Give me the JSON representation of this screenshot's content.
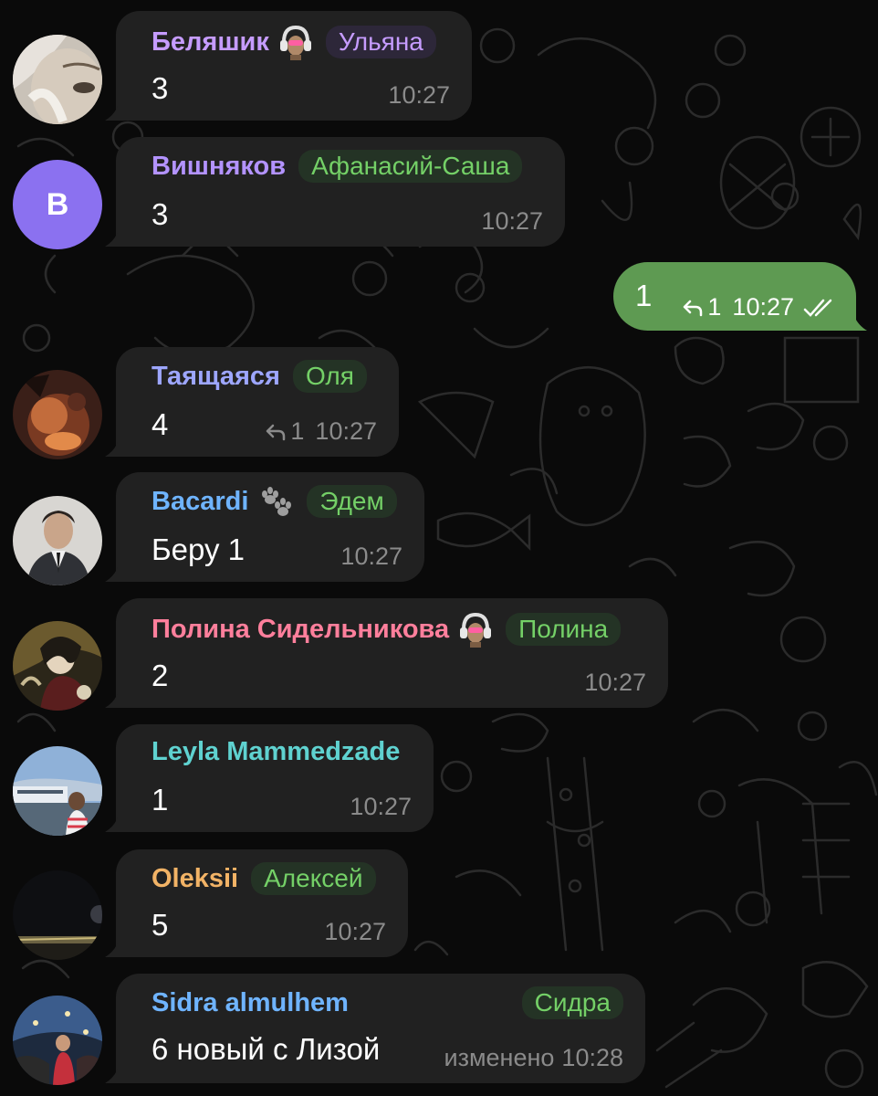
{
  "colors": {
    "background": "#0a0a0a",
    "bubble": "#212121",
    "outgoing_bubble": "#5e9a52",
    "meta": "#8b8b8b"
  },
  "outgoing": {
    "text": "1",
    "reply_count": "1",
    "time": "10:27",
    "status": "double-check-read"
  },
  "messages": [
    {
      "sender": "Беляшик",
      "sender_color": "#c69cff",
      "tag": "Ульяна",
      "tag_color": "#c69cff",
      "tag_bg": "#2d2739",
      "badge": "headphones-emoji",
      "text": "3",
      "time": "10:27",
      "avatar": "photo"
    },
    {
      "sender": "Вишняков",
      "sender_color": "#b393ff",
      "tag": "Афанасий-Саша",
      "tag_color": "#74d067",
      "tag_bg": "#243325",
      "text": "3",
      "time": "10:27",
      "avatar": "initial",
      "initial": "В",
      "avatar_color": "#8b71f0"
    },
    {
      "sender": "Таящаяся",
      "sender_color": "#9da6ff",
      "tag": "Оля",
      "tag_color": "#74d067",
      "tag_bg": "#243325",
      "text": "4",
      "reply_count": "1",
      "time": "10:27",
      "avatar": "photo"
    },
    {
      "sender": "Bacardi",
      "sender_color": "#6fb4ff",
      "badge": "paws-emoji",
      "tag": "Эдем",
      "tag_color": "#74d067",
      "tag_bg": "#243325",
      "text": "Беру 1",
      "time": "10:27",
      "avatar": "photo"
    },
    {
      "sender": "Полина Сидельникова",
      "sender_color": "#ff7f9c",
      "badge": "headphones-emoji",
      "tag": "Полина",
      "tag_color": "#74d067",
      "tag_bg": "#243325",
      "text": "2",
      "time": "10:27",
      "avatar": "photo"
    },
    {
      "sender": "Leyla Mammedzade",
      "sender_color": "#5fd2d0",
      "text": "1",
      "time": "10:27",
      "avatar": "photo"
    },
    {
      "sender": "Oleksii",
      "sender_color": "#f2b366",
      "tag": "Алексей",
      "tag_color": "#74d067",
      "tag_bg": "#243325",
      "text": "5",
      "time": "10:27",
      "avatar": "photo"
    },
    {
      "sender": "Sidra almulhem",
      "sender_color": "#6fb4ff",
      "tag": "Сидра",
      "tag_color": "#74d067",
      "tag_bg": "#243325",
      "text": "6 новый с Лизой",
      "edited": "изменено",
      "time": "10:28",
      "avatar": "photo"
    }
  ]
}
